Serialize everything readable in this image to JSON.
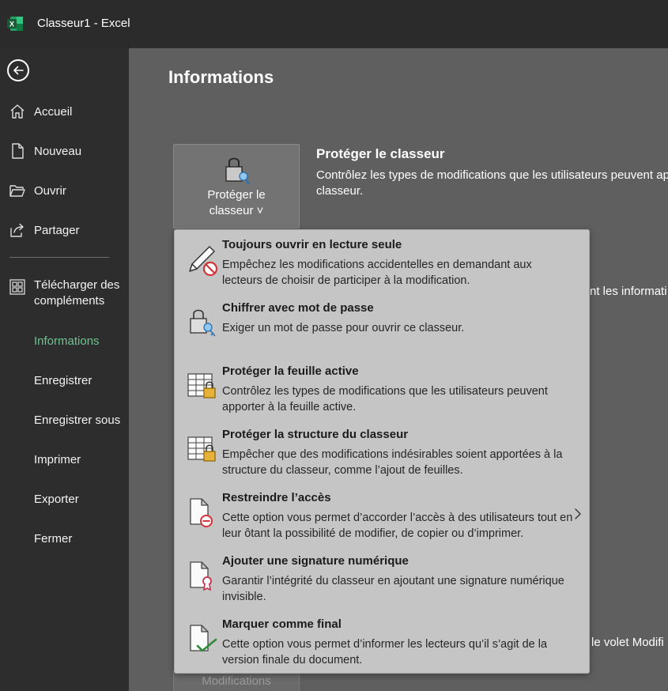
{
  "window": {
    "title": "Classeur1  -  Excel"
  },
  "sidebar": {
    "items": [
      {
        "label": "Accueil",
        "icon": "home-icon"
      },
      {
        "label": "Nouveau",
        "icon": "new-document-icon"
      },
      {
        "label": "Ouvrir",
        "icon": "open-folder-icon"
      },
      {
        "label": "Partager",
        "icon": "share-icon"
      },
      {
        "label": "Télécharger des compléments",
        "icon": "add-ins-icon"
      },
      {
        "label": "Informations",
        "active": true
      },
      {
        "label": "Enregistrer"
      },
      {
        "label": "Enregistrer sous"
      },
      {
        "label": "Imprimer"
      },
      {
        "label": "Exporter"
      },
      {
        "label": "Fermer"
      }
    ]
  },
  "main": {
    "title": "Informations",
    "protect_button": {
      "line1": "Protéger le",
      "line2": "classeur ˅"
    },
    "section": {
      "heading": "Protéger le classeur",
      "desc_line1": "Contrôlez les types de modifications que les utilisateurs peuvent ap",
      "desc_line2": "classeur."
    },
    "background_text_1": "nt les informati",
    "background_text_2": "le volet Modifi",
    "background_button": "Modifications"
  },
  "dropdown": {
    "items": [
      {
        "title": "Toujours ouvrir en lecture seule",
        "desc": "Empêchez les modifications accidentelles en demandant aux lecteurs de choisir de participer à la modification.",
        "icon": "pencil-no-icon"
      },
      {
        "title": "Chiffrer avec mot de passe",
        "desc": "Exiger un mot de passe pour ouvrir ce classeur.",
        "icon": "lock-key-icon"
      },
      {
        "title": "Protéger la feuille active",
        "desc": "Contrôlez les types de modifications que les utilisateurs peuvent apporter à la feuille active.",
        "icon": "sheet-lock-icon"
      },
      {
        "title": "Protéger la structure du classeur",
        "desc": "Empêcher que des modifications indésirables soient apportées à la structure du classeur, comme l’ajout de feuilles.",
        "icon": "workbook-lock-icon"
      },
      {
        "title": "Restreindre l’accès",
        "desc": "Cette option vous permet d’accorder l’accès à des utilisateurs tout en leur ôtant la possibilité de modifier, de copier ou d’imprimer.",
        "icon": "document-restrict-icon",
        "has_submenu": true
      },
      {
        "title": "Ajouter une signature numérique",
        "desc": "Garantir l’intégrité du classeur en ajoutant une signature numérique invisible.",
        "icon": "document-ribbon-icon"
      },
      {
        "title": "Marquer comme final",
        "desc": "Cette option vous permet d’informer les lecteurs qu’il s’agit de la version finale du document.",
        "icon": "document-check-icon"
      }
    ]
  },
  "colors": {
    "accent": "#6dc48e",
    "excel_green": "#1d6f42",
    "sidebar_bg": "#2d2d2d",
    "main_bg": "#5f5f5f",
    "dropdown_bg": "#c5c5c5"
  }
}
